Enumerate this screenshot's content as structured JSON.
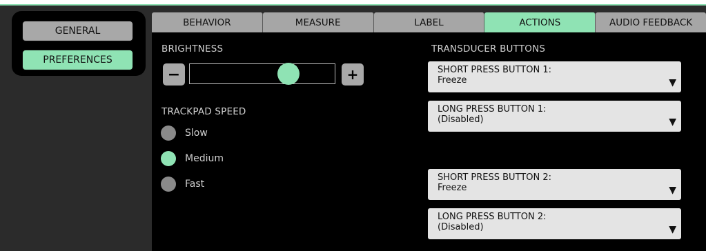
{
  "sidebar": {
    "items": [
      {
        "label": "GENERAL"
      },
      {
        "label": "PREFERENCES"
      }
    ]
  },
  "tabs": [
    {
      "label": "BEHAVIOR"
    },
    {
      "label": "MEASURE"
    },
    {
      "label": "LABEL"
    },
    {
      "label": "ACTIONS"
    },
    {
      "label": "AUDIO FEEDBACK"
    }
  ],
  "active_tab": "ACTIONS",
  "brightness": {
    "label": "BRIGHTNESS",
    "decrease_label": "−",
    "increase_label": "+",
    "level": 0.68
  },
  "trackpad_speed": {
    "label": "TRACKPAD SPEED",
    "options": [
      {
        "label": "Slow"
      },
      {
        "label": "Medium"
      },
      {
        "label": "Fast"
      }
    ],
    "selected": "Medium"
  },
  "transducer_buttons": {
    "label": "TRANSDUCER BUTTONS",
    "dropdowns": [
      {
        "title": "SHORT PRESS BUTTON 1:",
        "value": "Freeze"
      },
      {
        "title": "LONG PRESS BUTTON 1:",
        "value": "(Disabled)"
      },
      {
        "title": "SHORT PRESS BUTTON 2:",
        "value": "Freeze"
      },
      {
        "title": "LONG PRESS BUTTON 2:",
        "value": "(Disabled)"
      }
    ],
    "caret": "▼"
  },
  "colors": {
    "accent": "#8fe3b4",
    "inactive": "#a6a6a6",
    "panel": "#000000"
  }
}
